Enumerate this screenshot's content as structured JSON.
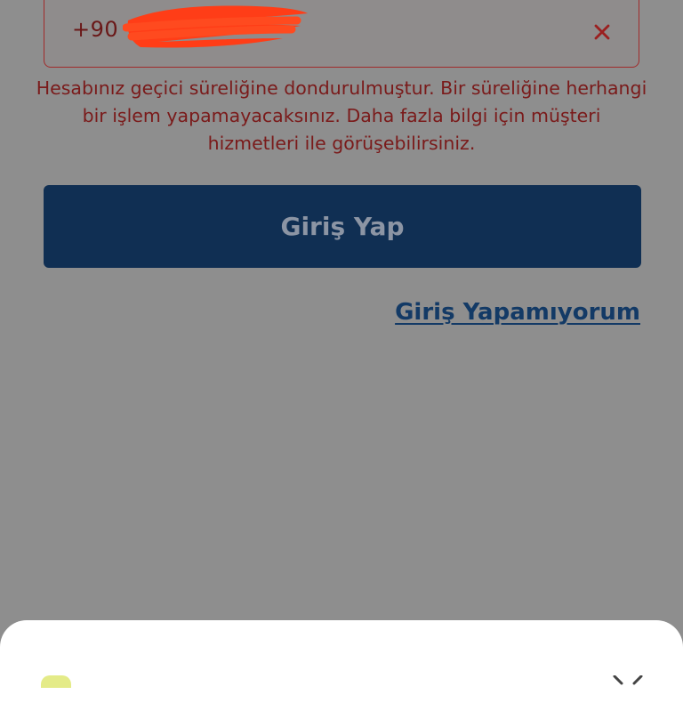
{
  "login_form": {
    "phone_field": {
      "country_code": "+90",
      "clear_icon": "close-icon"
    },
    "error_message": "Hesabınız geçici süreliğine dondurulmuştur. Bir süreliğine herhangi bir işlem yapamayacaksınız. Daha fazla bilgi için müşteri hizmetleri ile görüşebilirsiniz.",
    "login_button_label": "Giriş Yap",
    "help_link_label": "Giriş Yapamıyorum"
  },
  "bottom_sheet": {
    "close_icon": "close-icon"
  },
  "colors": {
    "error": "#a12a2a",
    "primary": "#102f53",
    "link": "#133a66",
    "overlay": "#8e8e8e"
  }
}
